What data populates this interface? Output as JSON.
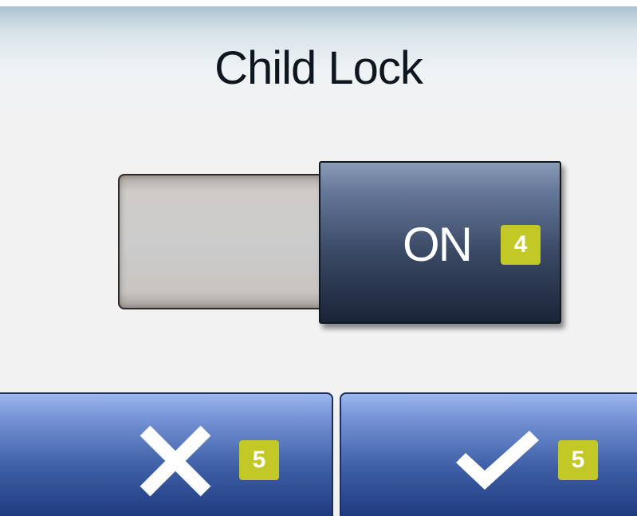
{
  "screen": {
    "title": "Child Lock"
  },
  "toggle": {
    "state_label": "ON",
    "badge": "4",
    "is_on": true
  },
  "buttons": {
    "cancel": {
      "icon": "close-icon",
      "badge": "5"
    },
    "confirm": {
      "icon": "checkmark-icon",
      "badge": "5"
    }
  },
  "colors": {
    "badge": "#c2c825",
    "knob_dark": "#1a2438",
    "button_blue": "#3e5fa6",
    "track_gray": "#cccccc"
  }
}
